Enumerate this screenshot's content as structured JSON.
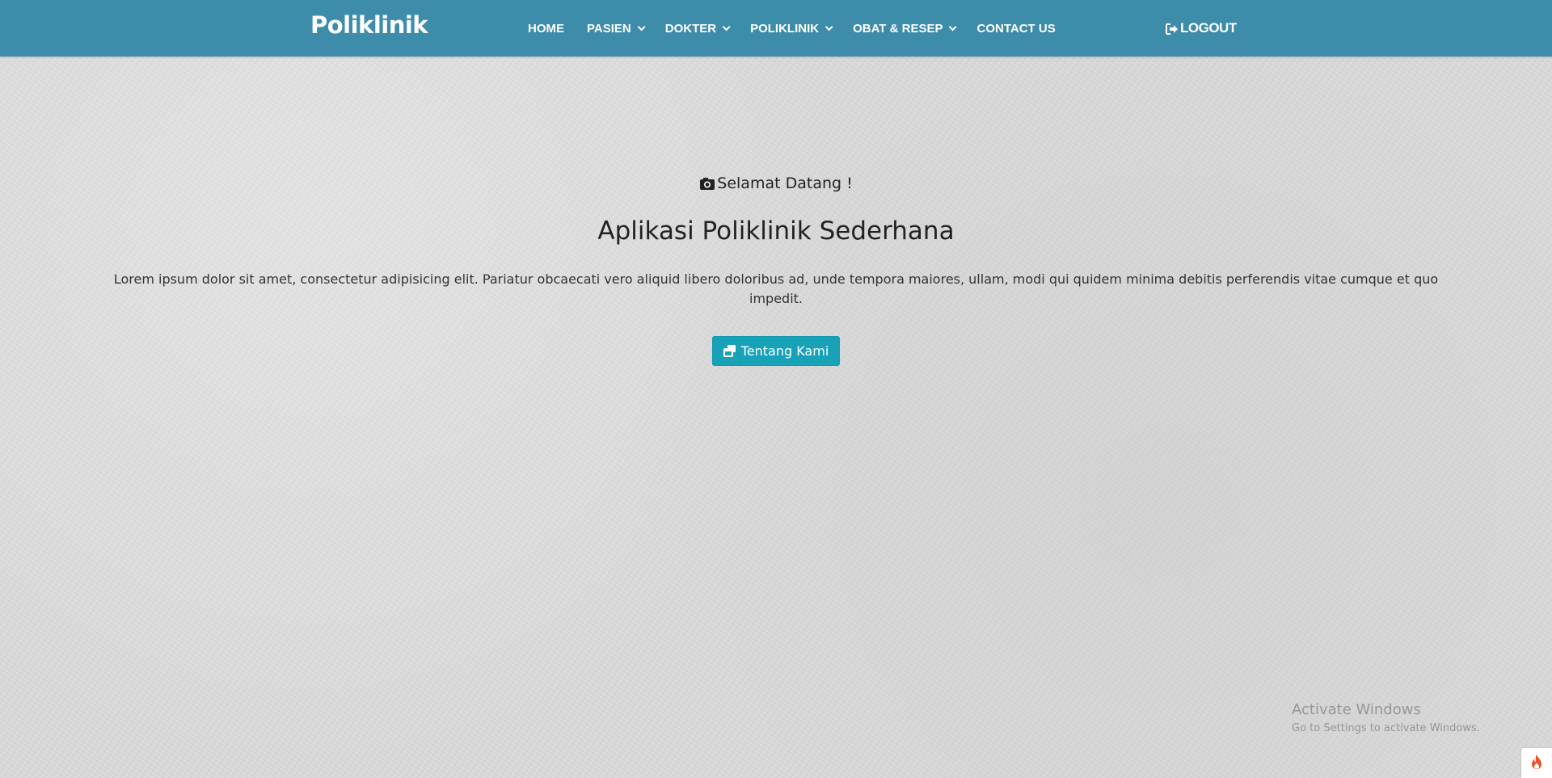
{
  "navbar": {
    "brand": "Poliklinik",
    "items": [
      {
        "label": "HOME",
        "dropdown": false
      },
      {
        "label": "PASIEN",
        "dropdown": true
      },
      {
        "label": "DOKTER",
        "dropdown": true
      },
      {
        "label": "POLIKLINIK",
        "dropdown": true
      },
      {
        "label": "OBAT & RESEP",
        "dropdown": true
      },
      {
        "label": "CONTACT US",
        "dropdown": false
      }
    ],
    "logout_label": "LOGOUT",
    "color": "#3d8ca9"
  },
  "hero": {
    "welcome": "Selamat Datang !",
    "title": "Aplikasi Poliklinik Sederhana",
    "description": "Lorem ipsum dolor sit amet, consectetur adipisicing elit. Pariatur obcaecati vero aliquid libero doloribus ad, unde tempora maiores, ullam, modi qui quidem minima debitis perferendis vitae cumque et quo impedit.",
    "button_label": "Tentang Kami",
    "button_color": "#17a2b8"
  },
  "watermark": {
    "title": "Activate Windows",
    "subtitle": "Go to Settings to activate Windows."
  },
  "icons": {
    "logout": "sign-out-icon",
    "welcome": "camera-icon",
    "button": "window-restore-icon",
    "corner": "flame-icon"
  }
}
